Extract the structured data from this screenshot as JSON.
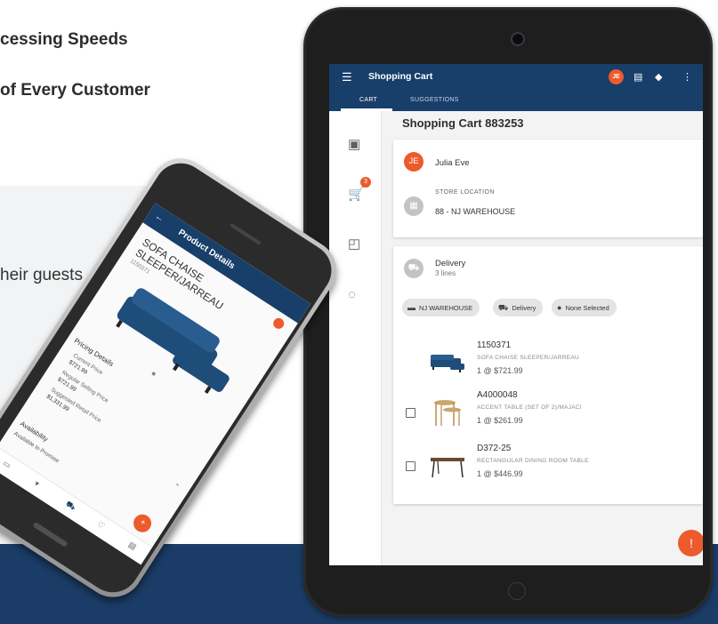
{
  "background": {
    "headline_1": "cessing Speeds",
    "headline_2": "of Every Customer",
    "body_fragment": "heir guests"
  },
  "tablet": {
    "app_title": "Shopping Cart",
    "user_initials": "JE",
    "tabs": [
      {
        "label": "CART",
        "active": true
      },
      {
        "label": "SUGGESTIONS",
        "active": false
      }
    ],
    "side_rail": {
      "cart_badge_count": "3"
    },
    "page_title": "Shopping Cart 883253",
    "customer": {
      "initials": "JE",
      "name": "Julia Eve"
    },
    "store": {
      "label": "STORE LOCATION",
      "value": "88 - NJ WAREHOUSE"
    },
    "delivery": {
      "title": "Delivery",
      "subtitle": "3 lines",
      "chips": [
        "NJ WAREHOUSE",
        "Delivery",
        "None Selected"
      ]
    },
    "items": [
      {
        "sku": "1150371",
        "description": "SOFA CHAISE SLEEPER/JARREAU",
        "price": "1 @ $721.99",
        "checkbox": false
      },
      {
        "sku": "A4000048",
        "description": "ACCENT TABLE (SET OF 2)/MAJACI",
        "price": "1 @ $261.99",
        "checkbox": true
      },
      {
        "sku": "D372-25",
        "description": "RECTANGULAR DINING ROOM TABLE",
        "price": "1 @ $446.99",
        "checkbox": true
      }
    ]
  },
  "phone": {
    "app_title": "Product Details",
    "product_name": "SOFA CHAISE SLEEPER/JARREAU",
    "sku": "1150371",
    "pricing": {
      "section_title": "Pricing Details",
      "current_label": "Current Price",
      "current_value": "$721.99",
      "regular_label": "Regular Selling Price",
      "regular_value": "$721.99",
      "suggested_label": "Suggested Retail Price",
      "suggested_value": "$1,331.99"
    },
    "availability": {
      "title": "Availability",
      "atp_label": "Available to Promise"
    }
  },
  "colors": {
    "brand_navy": "#183e6a",
    "accent_orange": "#ed5a2c",
    "band_navy": "#1b3c66"
  }
}
